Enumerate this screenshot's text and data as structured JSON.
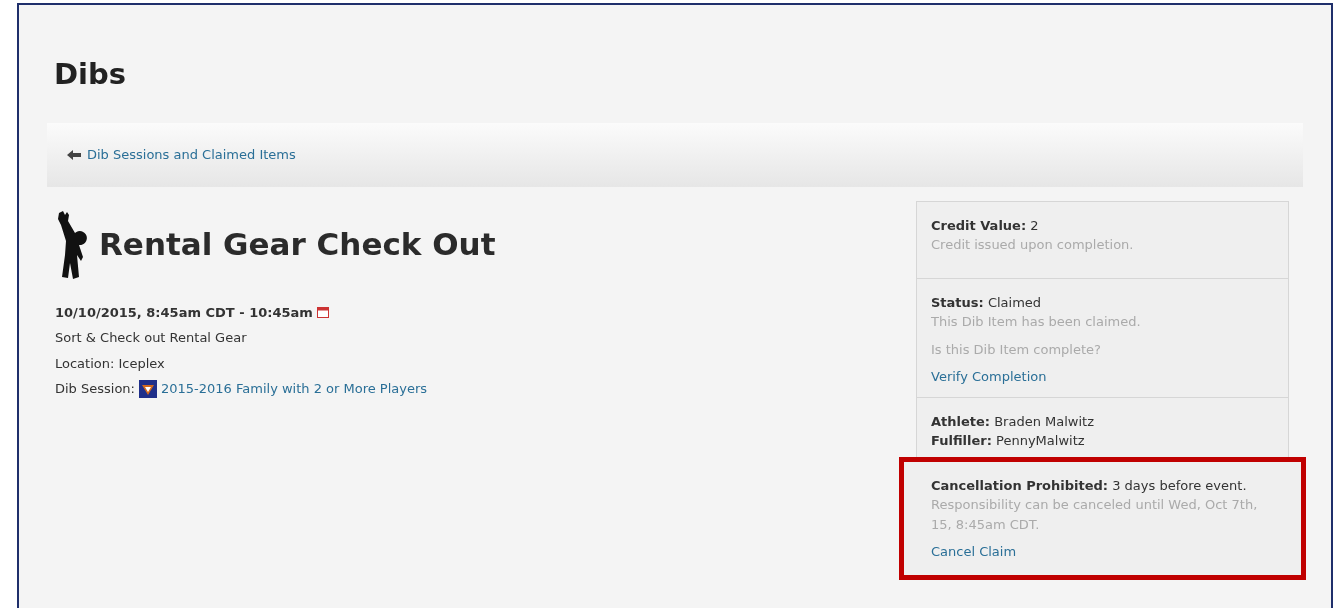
{
  "page_title": "Dibs",
  "breadcrumb": {
    "label": "Dib Sessions and Claimed Items"
  },
  "item": {
    "title": "Rental Gear Check Out",
    "datetime": "10/10/2015, 8:45am CDT - 10:45am",
    "description": "Sort & Check out Rental Gear",
    "location": "Location: Iceplex",
    "session_label": "Dib Session:",
    "session_link": "2015-2016 Family with 2 or More Players"
  },
  "panel": [
    {
      "highlighted": false,
      "lines": [
        {
          "kind": "field",
          "label": "Credit Value:",
          "value": "2"
        },
        {
          "kind": "note",
          "text": "Credit issued upon completion."
        }
      ]
    },
    {
      "highlighted": false,
      "lines": [
        {
          "kind": "field",
          "label": "Status:",
          "value": "Claimed"
        },
        {
          "kind": "note",
          "text": "This Dib Item has been claimed."
        },
        {
          "kind": "question",
          "text": "Is this Dib Item complete?"
        },
        {
          "kind": "link",
          "text": "Verify Completion"
        }
      ]
    },
    {
      "highlighted": false,
      "lines": [
        {
          "kind": "field",
          "label": "Athlete:",
          "value": "Braden Malwitz"
        },
        {
          "kind": "field",
          "label": "Fulfiller:",
          "value": "PennyMalwitz"
        }
      ]
    },
    {
      "highlighted": true,
      "lines": [
        {
          "kind": "field",
          "label": "Cancellation Prohibited:",
          "value": "3 days before event."
        },
        {
          "kind": "note",
          "text": "Responsibility can be canceled until Wed, Oct 7th, 15, 8:45am CDT."
        },
        {
          "kind": "link",
          "text": "Cancel Claim"
        }
      ]
    }
  ]
}
